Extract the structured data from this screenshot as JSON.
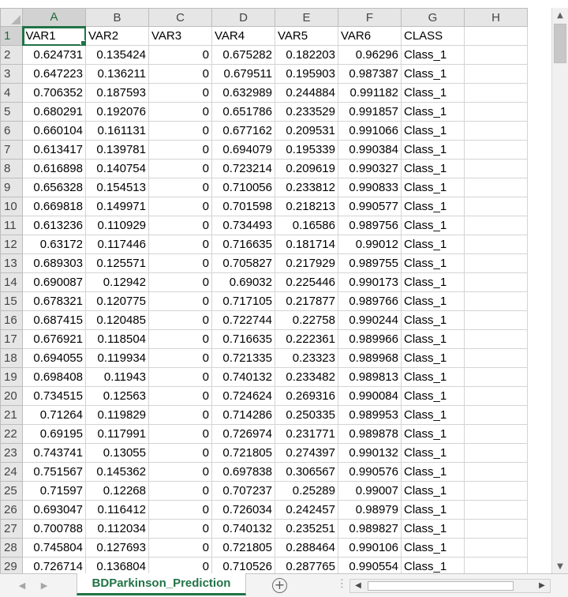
{
  "columns": [
    "A",
    "B",
    "C",
    "D",
    "E",
    "F",
    "G",
    "H"
  ],
  "active_column": "A",
  "active_row": "1",
  "header_row": {
    "row": "1",
    "cells": [
      "VAR1",
      "VAR2",
      "VAR3",
      "VAR4",
      "VAR5",
      "VAR6",
      "CLASS",
      ""
    ]
  },
  "rows": [
    {
      "row": "2",
      "cells": [
        "0.624731",
        "0.135424",
        "0",
        "0.675282",
        "0.182203",
        "0.96296",
        "Class_1",
        ""
      ]
    },
    {
      "row": "3",
      "cells": [
        "0.647223",
        "0.136211",
        "0",
        "0.679511",
        "0.195903",
        "0.987387",
        "Class_1",
        ""
      ]
    },
    {
      "row": "4",
      "cells": [
        "0.706352",
        "0.187593",
        "0",
        "0.632989",
        "0.244884",
        "0.991182",
        "Class_1",
        ""
      ]
    },
    {
      "row": "5",
      "cells": [
        "0.680291",
        "0.192076",
        "0",
        "0.651786",
        "0.233529",
        "0.991857",
        "Class_1",
        ""
      ]
    },
    {
      "row": "6",
      "cells": [
        "0.660104",
        "0.161131",
        "0",
        "0.677162",
        "0.209531",
        "0.991066",
        "Class_1",
        ""
      ]
    },
    {
      "row": "7",
      "cells": [
        "0.613417",
        "0.139781",
        "0",
        "0.694079",
        "0.195339",
        "0.990384",
        "Class_1",
        ""
      ]
    },
    {
      "row": "8",
      "cells": [
        "0.616898",
        "0.140754",
        "0",
        "0.723214",
        "0.209619",
        "0.990327",
        "Class_1",
        ""
      ]
    },
    {
      "row": "9",
      "cells": [
        "0.656328",
        "0.154513",
        "0",
        "0.710056",
        "0.233812",
        "0.990833",
        "Class_1",
        ""
      ]
    },
    {
      "row": "10",
      "cells": [
        "0.669818",
        "0.149971",
        "0",
        "0.701598",
        "0.218213",
        "0.990577",
        "Class_1",
        ""
      ]
    },
    {
      "row": "11",
      "cells": [
        "0.613236",
        "0.110929",
        "0",
        "0.734493",
        "0.16586",
        "0.989756",
        "Class_1",
        ""
      ]
    },
    {
      "row": "12",
      "cells": [
        "0.63172",
        "0.117446",
        "0",
        "0.716635",
        "0.181714",
        "0.99012",
        "Class_1",
        ""
      ]
    },
    {
      "row": "13",
      "cells": [
        "0.689303",
        "0.125571",
        "0",
        "0.705827",
        "0.217929",
        "0.989755",
        "Class_1",
        ""
      ]
    },
    {
      "row": "14",
      "cells": [
        "0.690087",
        "0.12942",
        "0",
        "0.69032",
        "0.225446",
        "0.990173",
        "Class_1",
        ""
      ]
    },
    {
      "row": "15",
      "cells": [
        "0.678321",
        "0.120775",
        "0",
        "0.717105",
        "0.217877",
        "0.989766",
        "Class_1",
        ""
      ]
    },
    {
      "row": "16",
      "cells": [
        "0.687415",
        "0.120485",
        "0",
        "0.722744",
        "0.22758",
        "0.990244",
        "Class_1",
        ""
      ]
    },
    {
      "row": "17",
      "cells": [
        "0.676921",
        "0.118504",
        "0",
        "0.716635",
        "0.222361",
        "0.989966",
        "Class_1",
        ""
      ]
    },
    {
      "row": "18",
      "cells": [
        "0.694055",
        "0.119934",
        "0",
        "0.721335",
        "0.23323",
        "0.989968",
        "Class_1",
        ""
      ]
    },
    {
      "row": "19",
      "cells": [
        "0.698408",
        "0.11943",
        "0",
        "0.740132",
        "0.233482",
        "0.989813",
        "Class_1",
        ""
      ]
    },
    {
      "row": "20",
      "cells": [
        "0.734515",
        "0.12563",
        "0",
        "0.724624",
        "0.269316",
        "0.990084",
        "Class_1",
        ""
      ]
    },
    {
      "row": "21",
      "cells": [
        "0.71264",
        "0.119829",
        "0",
        "0.714286",
        "0.250335",
        "0.989953",
        "Class_1",
        ""
      ]
    },
    {
      "row": "22",
      "cells": [
        "0.69195",
        "0.117991",
        "0",
        "0.726974",
        "0.231771",
        "0.989878",
        "Class_1",
        ""
      ]
    },
    {
      "row": "23",
      "cells": [
        "0.743741",
        "0.13055",
        "0",
        "0.721805",
        "0.274397",
        "0.990132",
        "Class_1",
        ""
      ]
    },
    {
      "row": "24",
      "cells": [
        "0.751567",
        "0.145362",
        "0",
        "0.697838",
        "0.306567",
        "0.990576",
        "Class_1",
        ""
      ]
    },
    {
      "row": "25",
      "cells": [
        "0.71597",
        "0.12268",
        "0",
        "0.707237",
        "0.25289",
        "0.99007",
        "Class_1",
        ""
      ]
    },
    {
      "row": "26",
      "cells": [
        "0.693047",
        "0.116412",
        "0",
        "0.726034",
        "0.242457",
        "0.98979",
        "Class_1",
        ""
      ]
    },
    {
      "row": "27",
      "cells": [
        "0.700788",
        "0.112034",
        "0",
        "0.740132",
        "0.235251",
        "0.989827",
        "Class_1",
        ""
      ]
    },
    {
      "row": "28",
      "cells": [
        "0.745804",
        "0.127693",
        "0",
        "0.721805",
        "0.288464",
        "0.990106",
        "Class_1",
        ""
      ]
    },
    {
      "row": "29",
      "cells": [
        "0.726714",
        "0.136804",
        "0",
        "0.710526",
        "0.287765",
        "0.990554",
        "Class_1",
        ""
      ]
    }
  ],
  "sheet_tab": {
    "label": "BDParkinson_Prediction"
  },
  "icons": {
    "scroll_up": "triangle-up-icon",
    "scroll_down": "triangle-down-icon",
    "prev_sheet": "triangle-left-icon",
    "next_sheet": "triangle-right-icon",
    "add_sheet": "plus-circle-icon"
  },
  "colors": {
    "accent": "#217346",
    "header_bg": "#e6e6e6",
    "gridline": "#d4d4d4"
  }
}
